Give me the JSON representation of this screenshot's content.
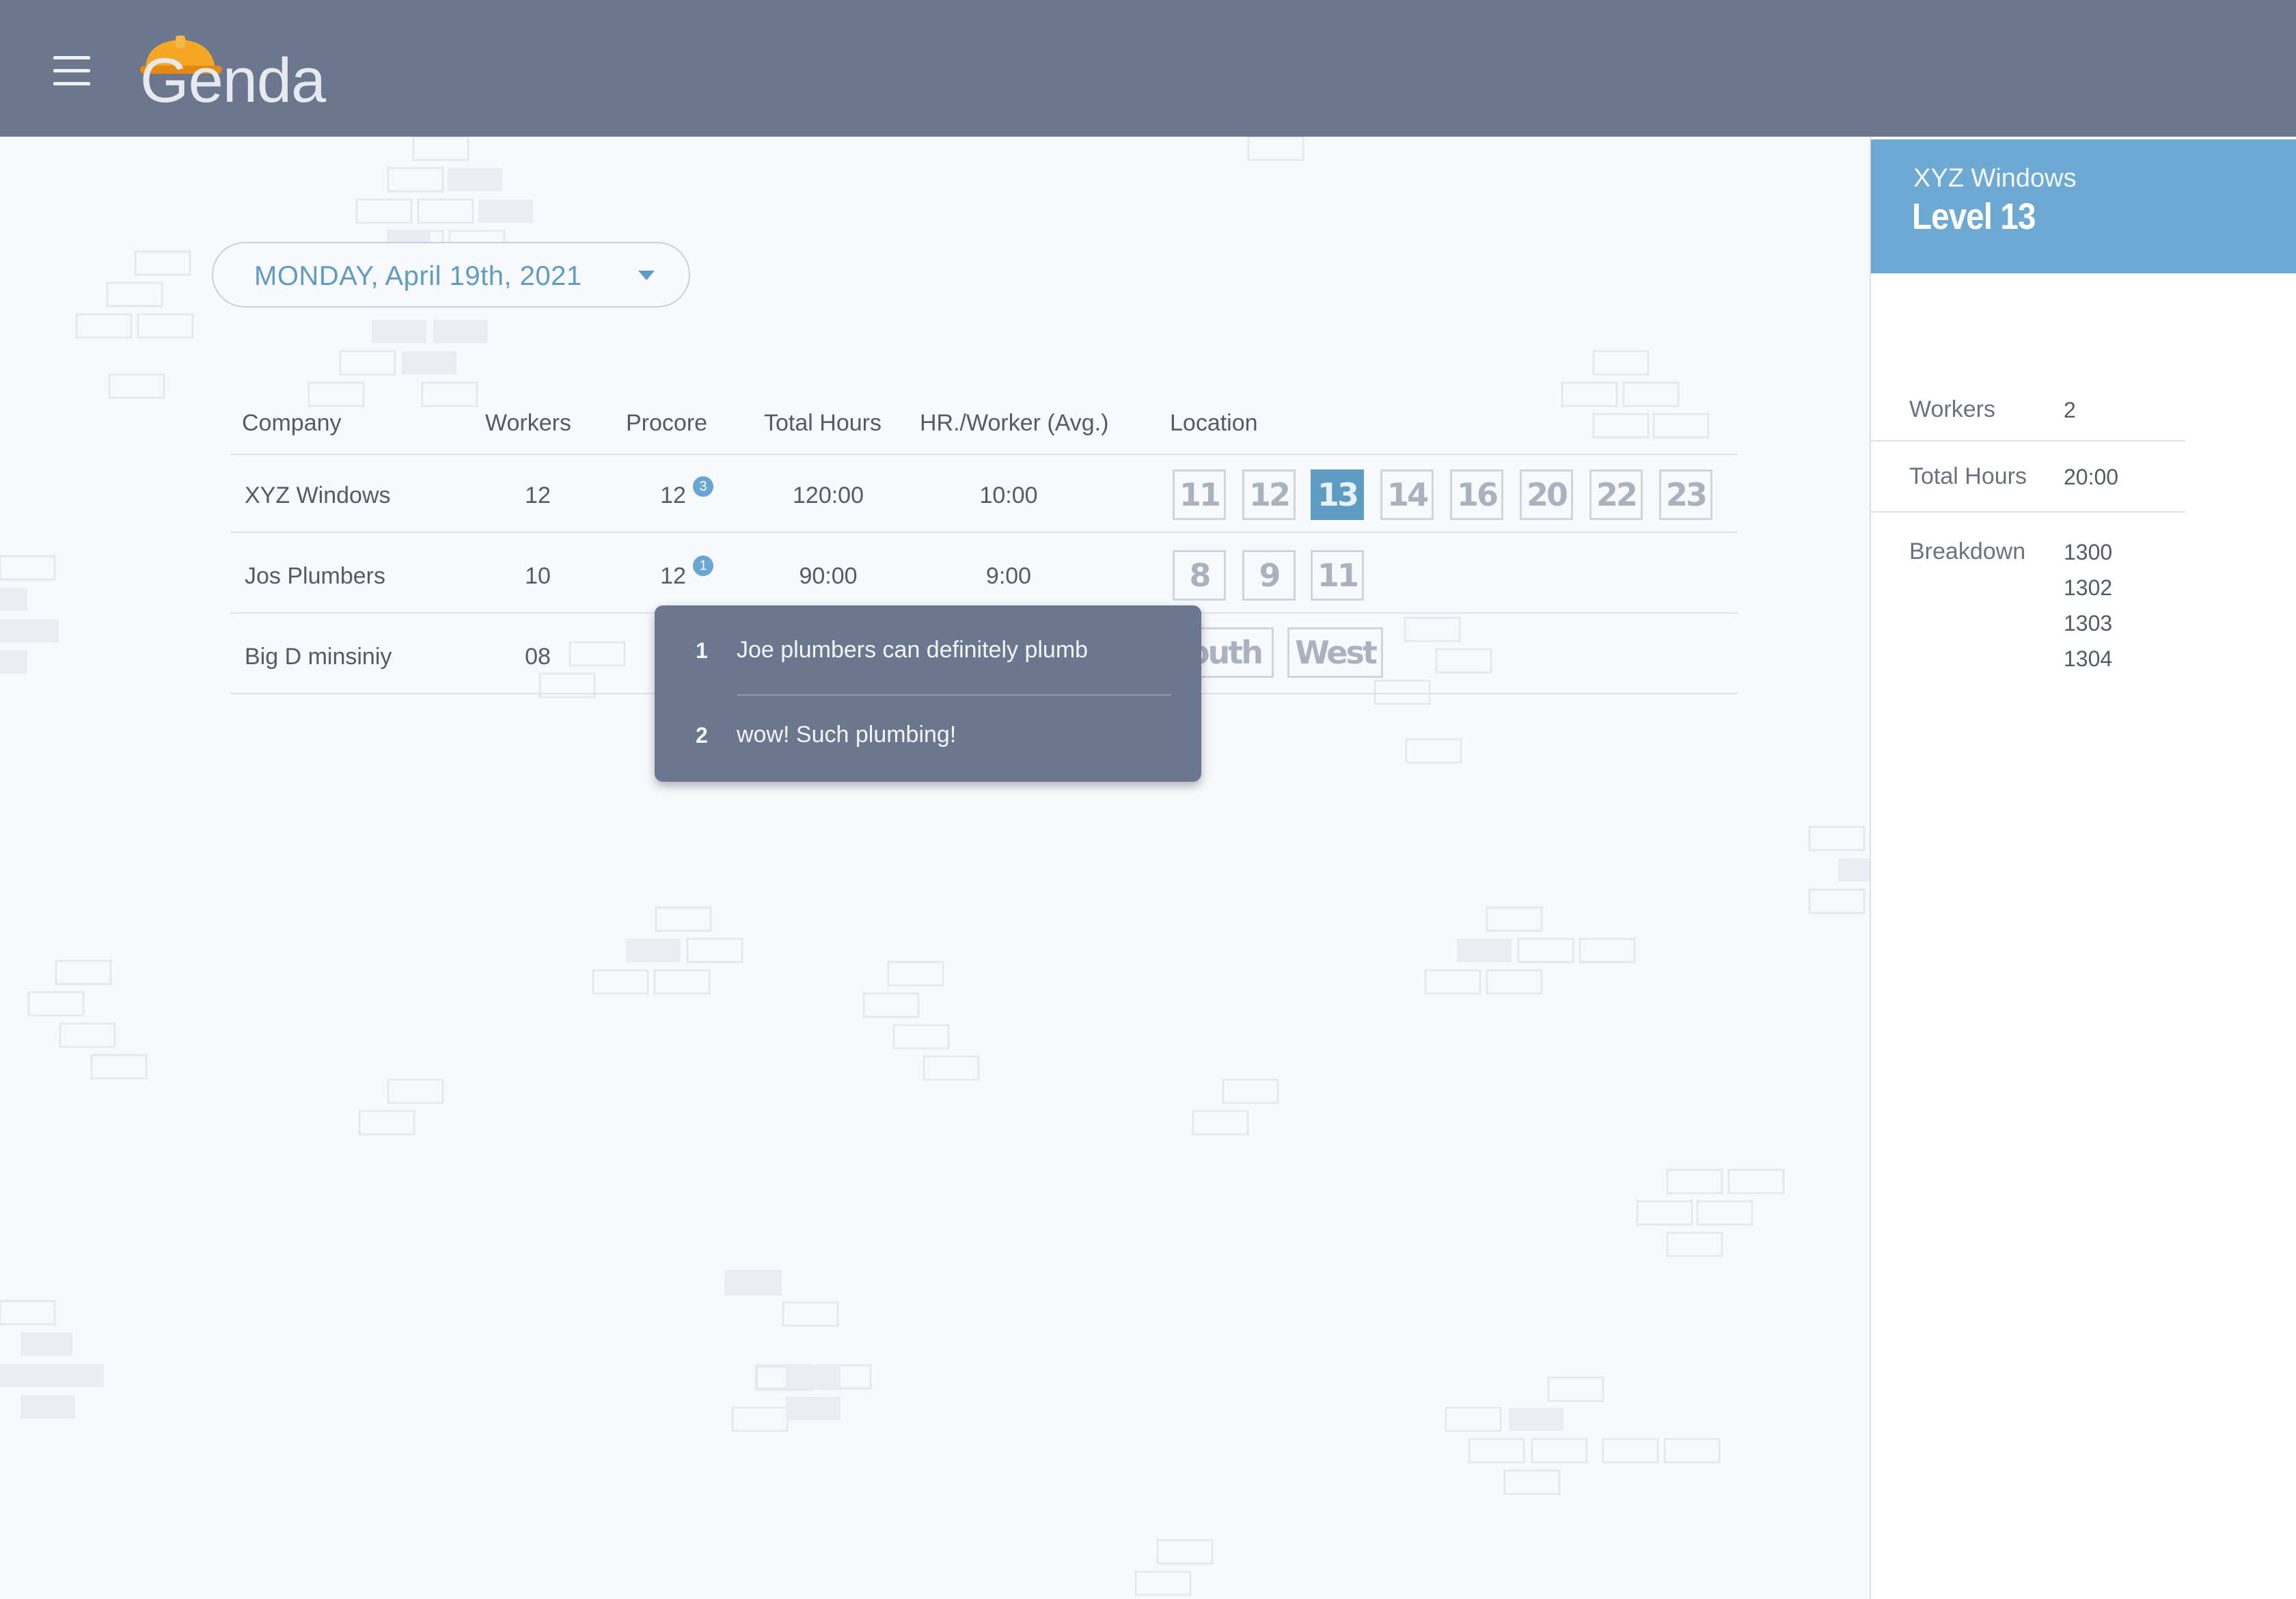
{
  "header": {
    "app_name": "enda",
    "logo_letter": "G",
    "menu_icon": "hamburger-icon",
    "logo_icon": "hard-hat-icon",
    "bar_color": "#6b768f",
    "hat_color": "#f5a623"
  },
  "date_picker": {
    "label": "MONDAY, April 19th, 2021",
    "icon": "caret-down-icon"
  },
  "table": {
    "columns": [
      "Company",
      "Workers",
      "Procore",
      "Total Hours",
      "HR./Worker (Avg.)",
      "Location"
    ],
    "rows": [
      {
        "company": "XYZ Windows",
        "workers": "12",
        "procore": "12",
        "procore_badge": "3",
        "total_hours": "120:00",
        "avg": "10:00",
        "locations": [
          "11",
          "12",
          "13",
          "14",
          "16",
          "20",
          "22",
          "23"
        ]
      },
      {
        "company": "Jos Plumbers",
        "workers": "10",
        "procore": "12",
        "procore_badge": "1",
        "total_hours": "90:00",
        "avg": "9:00",
        "locations": [
          "8",
          "9",
          "11"
        ]
      },
      {
        "company": "Big D minsiniy",
        "workers": "08",
        "locations": [
          "outh",
          "West"
        ]
      }
    ],
    "active_location": "13",
    "accent_color": "#5f9cc4"
  },
  "popup": {
    "items": [
      {
        "num": "1",
        "text": "Joe plumbers can definitely plumb"
      },
      {
        "num": "2",
        "text": "wow! Such plumbing!"
      }
    ]
  },
  "panel": {
    "company": "XYZ Windows",
    "level": "Level 13",
    "workers_label": "Workers",
    "workers_value": "2",
    "hours_label": "Total Hours",
    "hours_value": "20:00",
    "breakdown_label": "Breakdown",
    "breakdown": [
      "1300",
      "1302",
      "1303",
      "1304"
    ]
  }
}
